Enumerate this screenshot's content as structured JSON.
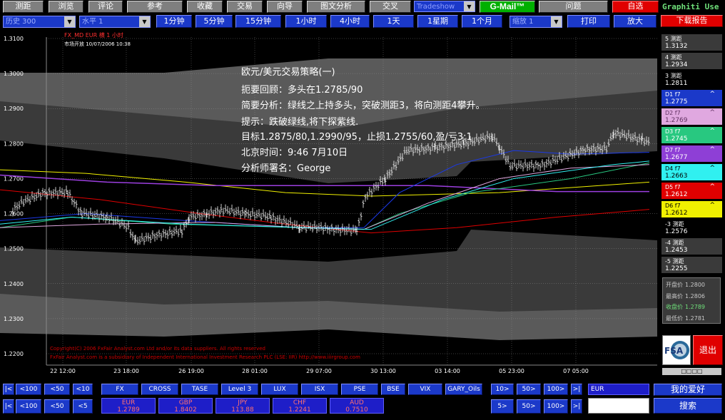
{
  "top_buttons": [
    {
      "id": "news",
      "label": "测距"
    },
    {
      "id": "browse",
      "label": "浏览"
    },
    {
      "id": "review",
      "label": "评论"
    },
    {
      "id": "forum",
      "label": "参考"
    },
    {
      "id": "favorites",
      "label": "收藏"
    },
    {
      "id": "trading",
      "label": "交易"
    },
    {
      "id": "guide",
      "label": "向导"
    },
    {
      "id": "chart_analysis",
      "label": "图文分析"
    },
    {
      "id": "quote",
      "label": "交叉"
    },
    {
      "id": "issue",
      "label": "问题"
    }
  ],
  "gmail_label": "G-Mail™",
  "tradeshow_select": "Tradeshow",
  "exit_label": "自选",
  "brand_label": "Graphiti Use",
  "download_label": "下载报告",
  "history_select": "历史 300",
  "level_select": "水平 1",
  "intervals": [
    "1分钟",
    "5分钟",
    "15分钟",
    "1小时",
    "4小时",
    "1天",
    "1星期",
    "1个月"
  ],
  "zoom_select": "缩放 1",
  "print_label": "打印",
  "enlarge_label": "放大",
  "chart": {
    "legend_line1": "FX_MD EUR 横  1  小时",
    "legend_line2": "市场开放 10/07/2006 10:38",
    "y_ticks": [
      "1.3100",
      "1.3000",
      "1.2900",
      "1.2800",
      "1.2700",
      "1.2600",
      "1.2500",
      "1.2400",
      "1.2300",
      "1.2200"
    ],
    "x_ticks": [
      "22 12:00",
      "23 18:00",
      "26 19:00",
      "28 01:00",
      "29 07:00",
      "30 13:00",
      "03 14:00",
      "05 23:00",
      "07 05:00"
    ],
    "note_lines": [
      "欧元/美元交易策略(一)",
      "扼要回顾：多头在1.2785/90",
      "简要分析：绿线之上持多头，突破测距3，将向测距4攀升。",
      "提示：跌破绿线,将下探紫线.",
      "目标1.2875/80,1.2990/95，止损1.2755/60,盈/亏3:1",
      "北京时间：9:46    7月10日",
      "分析师署名：George"
    ],
    "copyright1": "Copyright(C) 2006 FxFair Analyst.com Ltd and/or its data suppliers. All rights reserved",
    "copyright2": "FxFair Analyst.com is a subsidiary of Independent International Investment Research PLC (LSE: IIR) http://www.iiirgroup.com",
    "chart_data": {
      "type": "line",
      "x": [
        "22 12:00",
        "23 18:00",
        "26 19:00",
        "28 01:00",
        "29 07:00",
        "30 13:00",
        "03 14:00",
        "05 23:00",
        "07 05:00"
      ],
      "series": [
        {
          "values": [
            1.266,
            1.2545,
            1.259,
            1.259,
            1.2555,
            1.2765,
            1.279,
            1.274,
            1.28
          ]
        }
      ],
      "ylim": [
        1.22,
        1.31
      ],
      "grid": true
    }
  },
  "right_panel": [
    {
      "label": "5 测距",
      "value": "1.3132",
      "bg": "#3a3a3a",
      "fg": "#ffffff"
    },
    {
      "label": "4 测距",
      "value": "1.2934",
      "bg": "#3a3a3a",
      "fg": "#ffffff"
    },
    {
      "label": "3 测距",
      "value": "1.2811",
      "bg": "#000000",
      "fg": "#ffffff"
    },
    {
      "label": "D1 f7",
      "value": "1.2775",
      "bg": "#1b39c9",
      "fg": "#ffffff"
    },
    {
      "label": "D2 f7",
      "value": "1.2769",
      "bg": "#e0a8e0",
      "fg": "#603060"
    },
    {
      "label": "D3 f7",
      "value": "1.2745",
      "bg": "#28c880",
      "fg": "#ffffff"
    },
    {
      "label": "D7 f7",
      "value": "1.2677",
      "bg": "#8e3fd6",
      "fg": "#ffffff"
    },
    {
      "label": "D4 f7",
      "value": "1.2663",
      "bg": "#30f0f0",
      "fg": "#000000"
    },
    {
      "label": "D5 f7",
      "value": "1.2612",
      "bg": "#e00000",
      "fg": "#ffffff"
    },
    {
      "label": "D6 f7",
      "value": "1.2612",
      "bg": "#f0f000",
      "fg": "#000000"
    },
    {
      "label": "-3 测距",
      "value": "1.2576",
      "bg": "#000000",
      "fg": "#ffffff"
    },
    {
      "label": "-4 测距",
      "value": "1.2453",
      "bg": "#3a3a3a",
      "fg": "#ffffff"
    },
    {
      "label": "-5 测距",
      "value": "1.2255",
      "bg": "#3a3a3a",
      "fg": "#ffffff"
    }
  ],
  "ohlc": [
    {
      "label": "开盘价",
      "value": "1.2800",
      "color": "#c8c8c8"
    },
    {
      "label": "最高价",
      "value": "1.2806",
      "color": "#c8c8c8"
    },
    {
      "label": "收盘价",
      "value": "1.2789",
      "color": "#6fe07a"
    },
    {
      "label": "最低价",
      "value": "1.2781",
      "color": "#c8c8c8"
    }
  ],
  "fsa_label": "FSA",
  "logout_label": "退出",
  "scroll_dots": "□□□□",
  "nav_row1": [
    "|<",
    "<100",
    "<50",
    "<10"
  ],
  "nav_row2": [
    "|<",
    "<100",
    "<50",
    "<5"
  ],
  "nav_right1": [
    "10>",
    "50>",
    "100>",
    ">|"
  ],
  "nav_right2": [
    "5>",
    "50>",
    "100>",
    ">|"
  ],
  "indicator_tabs": [
    "FX",
    "CROSS",
    "TASE",
    "Level 3",
    "LUX",
    "ISX",
    "PSE",
    "BSE",
    "VIX",
    "GARY_Oils"
  ],
  "tickers": [
    {
      "name": "EUR",
      "price": "1.2789"
    },
    {
      "name": "GBP",
      "price": "1.8402"
    },
    {
      "name": "JPY",
      "price": "113.88"
    },
    {
      "name": "CHF",
      "price": "1.2241"
    },
    {
      "name": "AUD",
      "price": "0.7510"
    }
  ],
  "symbol_input": "EUR",
  "favorites_label": "我的爱好",
  "search_label": "搜索"
}
